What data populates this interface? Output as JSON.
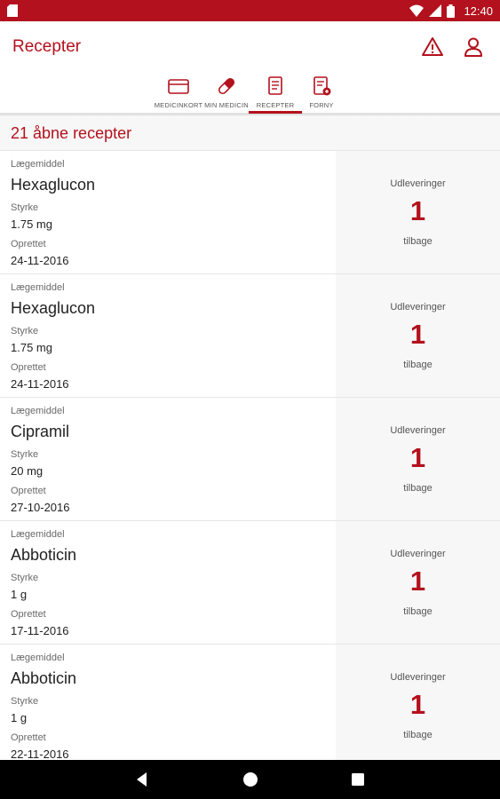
{
  "status_bar": {
    "time": "12:40",
    "icons": [
      "sd-card-icon",
      "wifi-icon",
      "signal-icon",
      "battery-icon"
    ]
  },
  "app_bar": {
    "title": "Recepter",
    "icons": [
      "warning-icon",
      "profile-icon"
    ]
  },
  "tabs": [
    {
      "label": "MEDICINKORT",
      "icon": "card-icon",
      "active": false
    },
    {
      "label": "MIN MEDICIN",
      "icon": "pill-icon",
      "active": false
    },
    {
      "label": "RECEPTER",
      "icon": "document-icon",
      "active": true
    },
    {
      "label": "FORNY",
      "icon": "renew-document-icon",
      "active": false
    }
  ],
  "list_header": {
    "count_text": "21 åbne recepter"
  },
  "prescriptions": [
    {
      "drug_label": "Lægemiddel",
      "drug": "Hexaglucon",
      "strength_label": "Styrke",
      "strength": "1.75 mg",
      "created_label": "Oprettet",
      "created": "24-11-2016",
      "deliveries_label": "Udleveringer",
      "deliveries": "1",
      "remaining_label": "tilbage"
    },
    {
      "drug_label": "Lægemiddel",
      "drug": "Hexaglucon",
      "strength_label": "Styrke",
      "strength": "1.75 mg",
      "created_label": "Oprettet",
      "created": "24-11-2016",
      "deliveries_label": "Udleveringer",
      "deliveries": "1",
      "remaining_label": "tilbage"
    },
    {
      "drug_label": "Lægemiddel",
      "drug": "Cipramil",
      "strength_label": "Styrke",
      "strength": "20 mg",
      "created_label": "Oprettet",
      "created": "27-10-2016",
      "deliveries_label": "Udleveringer",
      "deliveries": "1",
      "remaining_label": "tilbage"
    },
    {
      "drug_label": "Lægemiddel",
      "drug": "Abboticin",
      "strength_label": "Styrke",
      "strength": "1 g",
      "created_label": "Oprettet",
      "created": "17-11-2016",
      "deliveries_label": "Udleveringer",
      "deliveries": "1",
      "remaining_label": "tilbage"
    },
    {
      "drug_label": "Lægemiddel",
      "drug": "Abboticin",
      "strength_label": "Styrke",
      "strength": "1 g",
      "created_label": "Oprettet",
      "created": "22-11-2016",
      "deliveries_label": "Udleveringer",
      "deliveries": "1",
      "remaining_label": "tilbage"
    }
  ],
  "nav_bar": {
    "buttons": [
      "back-icon",
      "home-icon",
      "recents-icon"
    ]
  },
  "colors": {
    "brand": "#b3111d",
    "row_highlight": "#f7f7f7",
    "nav": "#000000"
  }
}
